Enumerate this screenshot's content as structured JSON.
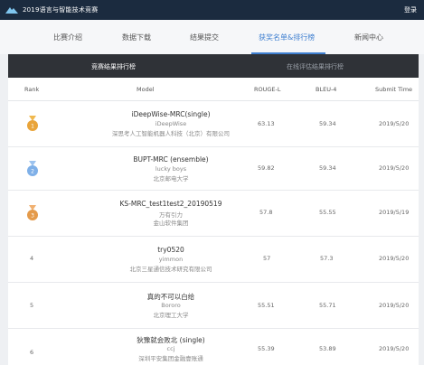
{
  "app": {
    "title": "2019语言与智能技术竞赛",
    "login_label": "登录"
  },
  "nav": {
    "items": [
      {
        "label": "比赛介绍"
      },
      {
        "label": "数据下载"
      },
      {
        "label": "结果提交"
      },
      {
        "label": "获奖名单&排行榜"
      },
      {
        "label": "新闻中心"
      }
    ],
    "active_index": 3
  },
  "subtabs": {
    "active": "竞赛结果排行榜",
    "inactive": "在线评估结果排行榜"
  },
  "table": {
    "headers": {
      "rank": "Rank",
      "model": "Model",
      "rouge": "ROUGE-L",
      "bleu": "BLEU-4",
      "time": "Submit Time"
    },
    "rows": [
      {
        "rank": "1",
        "medal": "gold",
        "name": "iDeepWise-MRC(single)",
        "team": "iDeepWise",
        "org": "深思考人工智能机器人科技（北京）有限公司",
        "rouge": "63.13",
        "bleu": "59.34",
        "time": "2019/5/20"
      },
      {
        "rank": "2",
        "medal": "silver",
        "name": "BUPT-MRC (ensemble)",
        "team": "lucky boys",
        "org": "北京邮电大学",
        "rouge": "59.82",
        "bleu": "59.34",
        "time": "2019/5/20"
      },
      {
        "rank": "3",
        "medal": "bronze",
        "name": "KS-MRC_test1test2_20190519",
        "team": "万有引力",
        "org": "金山软件集团",
        "rouge": "57.8",
        "bleu": "55.55",
        "time": "2019/5/19"
      },
      {
        "rank": "4",
        "medal": "",
        "name": "try0520",
        "team": "yimmon",
        "org": "北京三星通信技术研究有限公司",
        "rouge": "57",
        "bleu": "57.3",
        "time": "2019/5/20"
      },
      {
        "rank": "5",
        "medal": "",
        "name": "真的不可以白给",
        "team": "Bororo",
        "org": "北京理工大学",
        "rouge": "55.51",
        "bleu": "55.71",
        "time": "2019/5/20"
      },
      {
        "rank": "6",
        "medal": "",
        "name": "狄豫就会败北 (single)",
        "team": "ccj",
        "org": "深圳平安集团金融壹账通",
        "rouge": "55.39",
        "bleu": "53.89",
        "time": "2019/5/20"
      }
    ]
  },
  "colors": {
    "topbar": "#1b2b3f",
    "accent": "#3f7fd0",
    "subtab_bg": "#2f3237",
    "gold": "#e9a43a",
    "silver": "#7fb0e8",
    "bronze": "#e49a4a"
  }
}
